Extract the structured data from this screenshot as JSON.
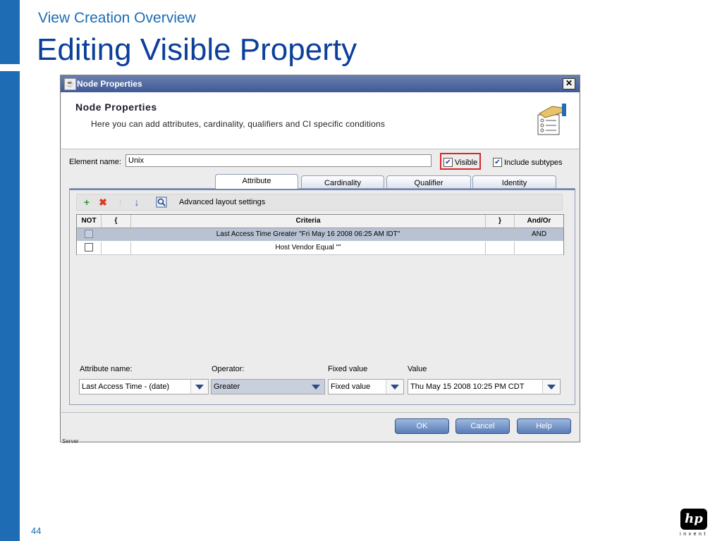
{
  "slide": {
    "subtitle": "View Creation Overview",
    "title": "Editing Visible Property",
    "page_number": "44",
    "logo_mark": "hp",
    "logo_word": "invent",
    "accent_color": "#1d6cb4",
    "title_color": "#0b3f9a"
  },
  "dialog": {
    "window_title": "Node Properties",
    "close_glyph": "✕",
    "header_title": "Node Properties",
    "header_description": "Here you can add attributes, cardinality, qualifiers and CI specific conditions",
    "header_icon": "hand-pointing-checklist-icon",
    "element_name_label": "Element name:",
    "element_name_value": "Unix",
    "visible_label": "Visible",
    "visible_checked": true,
    "include_subtypes_label": "Include subtypes",
    "include_subtypes_checked": true,
    "highlight_color": "#d62828",
    "tabs": [
      {
        "label": "Attribute",
        "active": true
      },
      {
        "label": "Cardinality",
        "active": false
      },
      {
        "label": "Qualifier",
        "active": false
      },
      {
        "label": "Identity",
        "active": false
      }
    ],
    "toolbar": {
      "add_icon": "plus-icon",
      "delete_icon": "red-x-icon",
      "move_up_icon": "arrow-up-icon",
      "move_down_icon": "arrow-down-icon",
      "layout_icon": "magnifier-icon",
      "advanced_label": "Advanced layout settings"
    },
    "grid": {
      "headers": [
        "NOT",
        "{",
        "Criteria",
        "}",
        "And/Or"
      ],
      "rows": [
        {
          "not": false,
          "open": "",
          "criteria": "Last Access Time  Greater  \"Fri May 16 2008 06:25 AM IDT\"",
          "close": "",
          "and_or": "AND",
          "selected": true
        },
        {
          "not": false,
          "open": "",
          "criteria": "Host Vendor  Equal  \"\"",
          "close": "",
          "and_or": "",
          "selected": false
        }
      ]
    },
    "fields": {
      "attribute_name_label": "Attribute name:",
      "attribute_name_value": "Last Access Time - (date)",
      "operator_label": "Operator:",
      "operator_value": "Greater",
      "fixed_value_label": "Fixed value",
      "fixed_value_value": "Fixed value",
      "value_label": "Value",
      "value_value": "Thu May 15 2008 10:25 PM CDT"
    },
    "buttons": {
      "ok": "OK",
      "cancel": "Cancel",
      "help": "Help"
    }
  },
  "background_residue": "Server"
}
